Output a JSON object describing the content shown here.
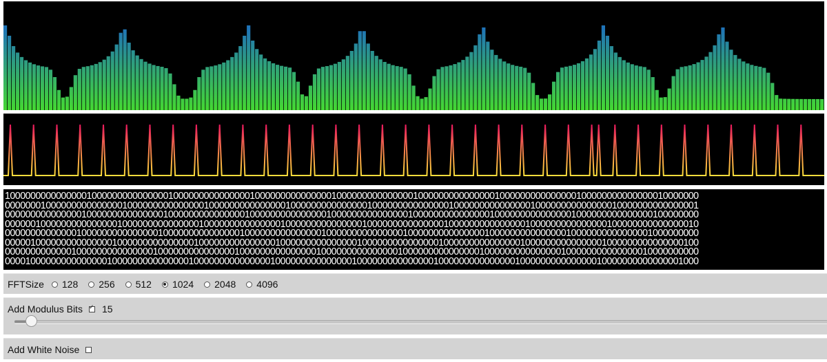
{
  "colors": {
    "spectrum_top": "#1f74b8",
    "spectrum_bottom": "#44d832",
    "wave_top": "#e8185c",
    "wave_bottom": "#ffde3c",
    "panel_bg": "#000000",
    "control_bg": "#d3d3d3"
  },
  "bit_lines": [
    "1000000000000000100000000000000010000000000000001000000000000000100000000000000010000000000000001000000000000000100000000000000010000000",
    "0000000100000000000000010000000000000001000000000000000100000000000000010000000000000001000000000000000100000000000000010000000000000001",
    "0000000000000001000000000000000100000000000000010000000000000001000000000000000100000000000000010000000000000001000000000000000100000000",
    "0000001000000000000000100000000000000010000000000000001000000000000000100000000000000010000000000000001000000000000000100000000000000010",
    "0000000000000010000000000000001000000000000000100000000000000010000000000000001000000000000000100000000000000010000000000000001000000000",
    "0000010000000000000001000000000000000100000000000000010000000000000001000000000000000100000000000000010000000000000001000000000000000100",
    "0000000000000100000000000000010000000000000001000000000000000100000000000000010000000000000001000000000000000100000000000000010000000000",
    "0000100000000000000010000000000000001000000000000000100000000000000010000000000000001000000000000000100000000000000010000000000000001000"
  ],
  "fft": {
    "label": "FFTSize",
    "options": [
      "128",
      "256",
      "512",
      "1024",
      "2048",
      "4096"
    ],
    "selected": "1024"
  },
  "modulus": {
    "label": "Add Modulus Bits",
    "checked": true,
    "value": "15",
    "slider_fraction": 0.02
  },
  "noise": {
    "label": "Add White Noise",
    "checked": false
  },
  "spectrum_peaks": [
    0.2,
    28.6,
    58.8,
    86.5,
    115.7,
    145.2,
    173.7
  ],
  "wave_pulse_count": 35,
  "wave_extra_pulse": 25.3
}
